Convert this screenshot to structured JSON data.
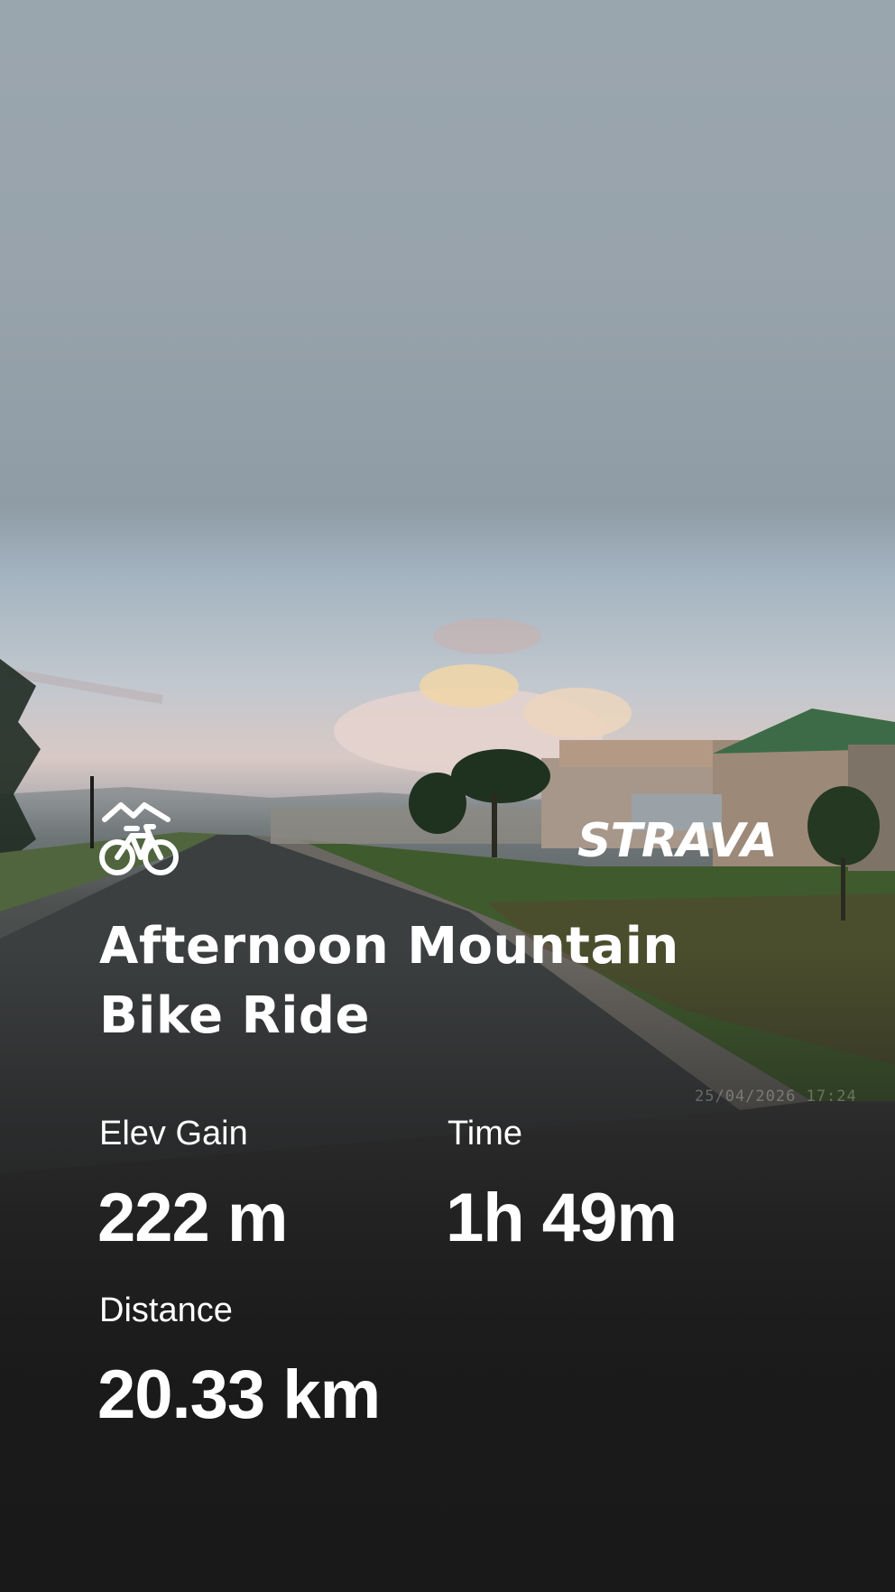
{
  "activity": {
    "title": "Afternoon Mountain Bike Ride",
    "type_icon": "mountain-bike-icon"
  },
  "brand": {
    "logo_text": "STRAVA"
  },
  "photo": {
    "timestamp": "25/04/2026  17:24"
  },
  "stats": [
    {
      "label": "Elev Gain",
      "value": "222 m"
    },
    {
      "label": "Time",
      "value": "1h 49m"
    },
    {
      "label": "Distance",
      "value": "20.33 km"
    }
  ]
}
